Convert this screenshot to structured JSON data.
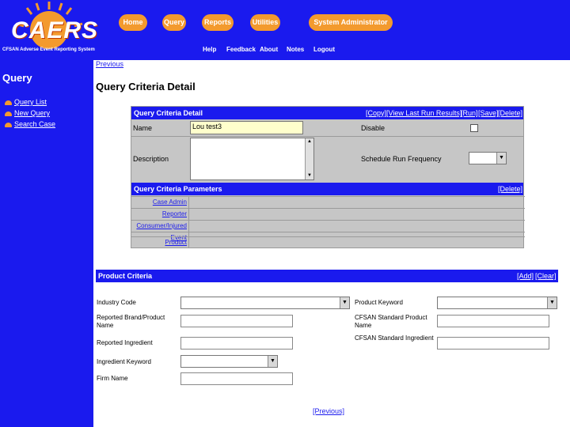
{
  "header": {
    "logo_text": "CAERS",
    "logo_subtitle": "CFSAN Adverse Event Reporting System",
    "main_nav": [
      "Home",
      "Query",
      "Reports",
      "Utilities",
      "System Administrator"
    ],
    "sub_nav": [
      "Help",
      "Feedback",
      "About",
      "Notes",
      "Logout"
    ],
    "accent": "#f39a2e",
    "blue": "#1a1aee"
  },
  "sidebar": {
    "heading": "Query",
    "items": [
      {
        "label": "Query List",
        "icon": "orange-bullet-icon"
      },
      {
        "label": "New Query",
        "icon": "orange-bullet-icon"
      },
      {
        "label": "Search Case",
        "icon": "orange-bullet-icon"
      }
    ]
  },
  "main": {
    "previous_top": "Previous",
    "title": "Query Criteria Detail",
    "detail": {
      "bar_title": "Query Criteria Detail",
      "actions": [
        "[Copy]",
        "[View Last Run Results]",
        "[Run]",
        "[Save]",
        "[Delete]"
      ],
      "name_label": "Name",
      "name_value": "Lou test3",
      "disable_label": "Disable",
      "description_label": "Description",
      "description_value": "",
      "frequency_label": "Schedule Run Frequency",
      "frequency_value": ""
    },
    "parameters": {
      "bar_title": "Query Criteria Parameters",
      "delete_label": "[Delete]",
      "rows": [
        "Case Admin",
        "Reporter",
        "Consumer/Injured",
        "Event",
        "Product"
      ]
    },
    "product": {
      "bar_title": "Product Criteria",
      "add_label": "[Add]",
      "clear_label": "[Clear]",
      "industry_code_label": "Industry Code",
      "product_keyword_label": "Product Keyword",
      "reported_brand_label": "Reported Brand/Product Name",
      "cfsan_product_label": "CFSAN Standard Product Name",
      "reported_ingredient_label": "Reported Ingredient",
      "cfsan_ingredient_label": "CFSAN Standard Ingredient",
      "ingredient_keyword_label": "Ingredient Keyword",
      "firm_name_label": "Firm Name"
    },
    "previous_bottom": "[Previous]"
  }
}
